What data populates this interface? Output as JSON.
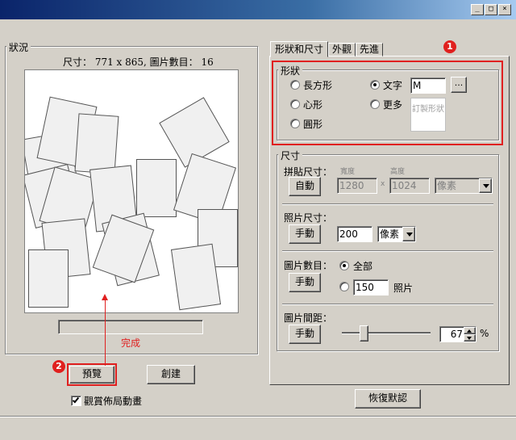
{
  "window": {
    "min": "_",
    "max": "□",
    "close": "×"
  },
  "status": {
    "legend": "狀況",
    "info": "尺寸： 771 x 865, 圖片數目： 16",
    "done": "完成"
  },
  "tabs": [
    "形狀和尺寸",
    "外觀",
    "先進"
  ],
  "shape": {
    "legend": "形狀",
    "rect": "長方形",
    "heart": "心形",
    "circle": "圓形",
    "text": "文字",
    "more": "更多",
    "text_value": "M",
    "browse": "...",
    "custom": "訂製形狀"
  },
  "size": {
    "legend": "尺寸",
    "collage_label": "拼貼尺寸：",
    "collage_btn": "自動",
    "width_label": "寬度",
    "height_label": "高度",
    "width_value": "1280",
    "x": "x",
    "height_value": "1024",
    "unit1": "像素",
    "photo_label": "照片尺寸：",
    "photo_btn": "手動",
    "photo_value": "200",
    "unit2": "像素",
    "count_label": "圖片數目：",
    "count_btn": "手動",
    "all": "全部",
    "count_value": "150",
    "photos": "照片",
    "spacing_label": "圖片間距：",
    "spacing_btn": "手動",
    "spacing_value": "67",
    "percent": "%"
  },
  "bottom": {
    "preview": "預覽",
    "create": "創建",
    "animate": "觀賞佈局動畫",
    "restore": "恢復默認"
  },
  "badges": {
    "one": "1",
    "two": "2"
  },
  "colors": {
    "highlight": "#e02020",
    "title_start": "#0a246a",
    "title_end": "#a6caf0"
  }
}
